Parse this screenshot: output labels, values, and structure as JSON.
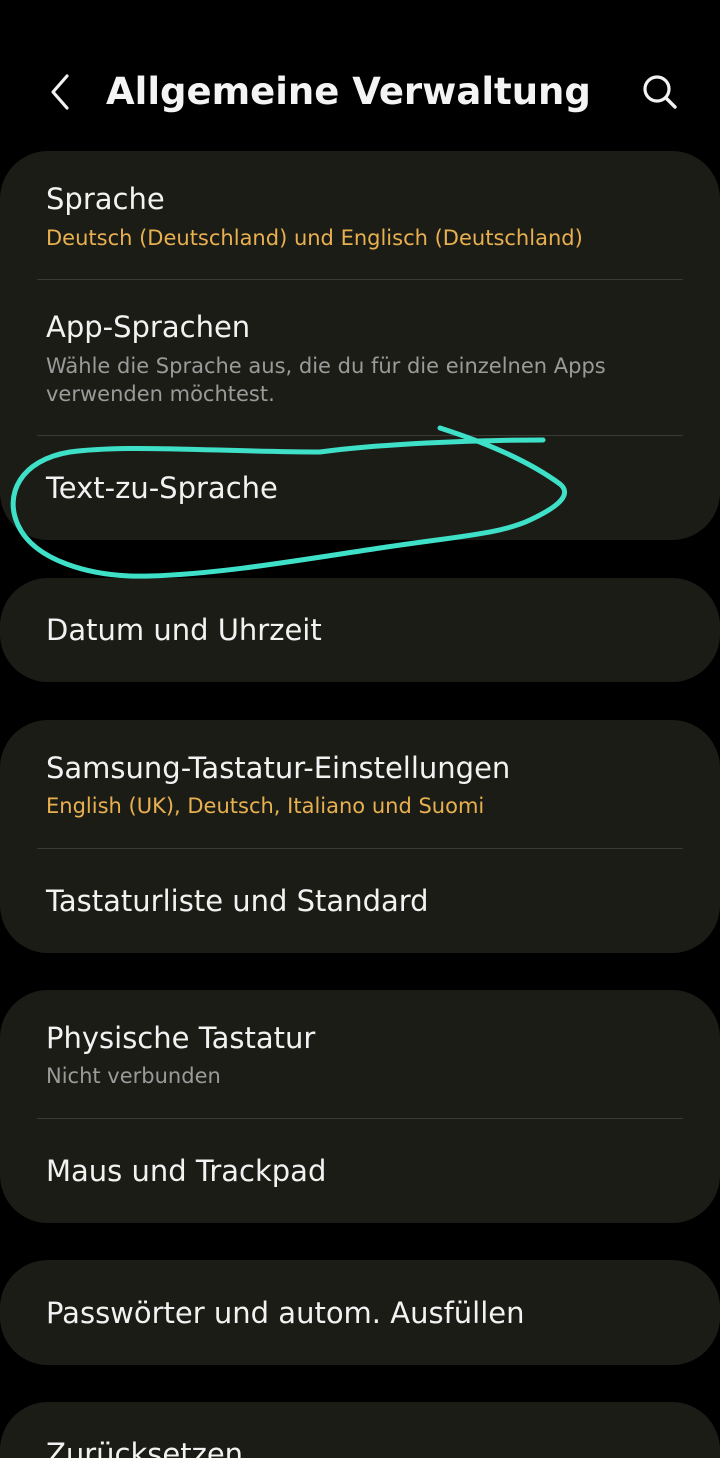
{
  "header": {
    "title": "Allgemeine Verwaltung",
    "back_icon": "chevron-left-icon",
    "search_icon": "search-icon"
  },
  "colors": {
    "background": "#000000",
    "card": "#1c1c17",
    "accent": "#e8b04f",
    "annotation": "#3ee0c8"
  },
  "groups": [
    {
      "items": [
        {
          "title": "Sprache",
          "subtitle": "Deutsch (Deutschland) und Englisch (Deutschland)"
        },
        {
          "title": "App-Sprachen",
          "subtitle": "Wähle die Sprache aus, die du für die einzelnen Apps verwenden möchtest."
        },
        {
          "title": "Text-zu-Sprache"
        }
      ]
    },
    {
      "items": [
        {
          "title": "Datum und Uhrzeit"
        }
      ]
    },
    {
      "items": [
        {
          "title": "Samsung-Tastatur-Einstellungen",
          "subtitle": "English (UK), Deutsch, Italiano und Suomi"
        },
        {
          "title": "Tastaturliste und Standard"
        }
      ]
    },
    {
      "items": [
        {
          "title": "Physische Tastatur",
          "subtitle": "Nicht verbunden"
        },
        {
          "title": "Maus und Trackpad"
        }
      ]
    },
    {
      "items": [
        {
          "title": "Passwörter und autom. Ausfüllen"
        }
      ]
    },
    {
      "items": [
        {
          "title": "Zurücksetzen"
        }
      ]
    }
  ]
}
